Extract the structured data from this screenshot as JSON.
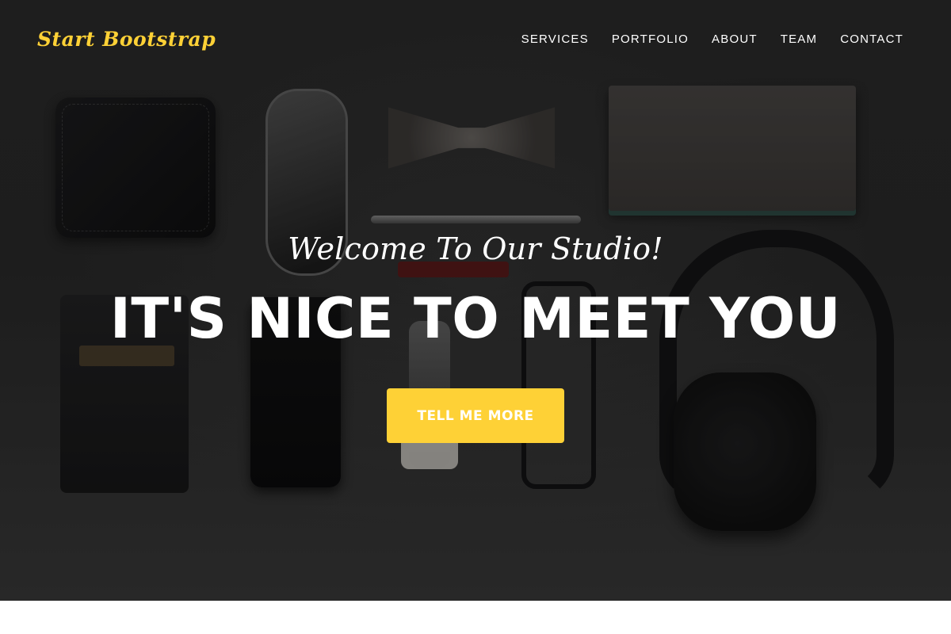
{
  "navbar": {
    "brand": "Start Bootstrap",
    "links": [
      {
        "label": "SERVICES"
      },
      {
        "label": "PORTFOLIO"
      },
      {
        "label": "ABOUT"
      },
      {
        "label": "TEAM"
      },
      {
        "label": "CONTACT"
      }
    ]
  },
  "hero": {
    "lead_in": "Welcome To Our Studio!",
    "heading": "IT'S NICE TO MEET YOU",
    "button_label": "TELL ME MORE"
  },
  "colors": {
    "accent": "#fed136",
    "text_on_dark": "#ffffff",
    "background_dark": "#2a2a2a"
  }
}
